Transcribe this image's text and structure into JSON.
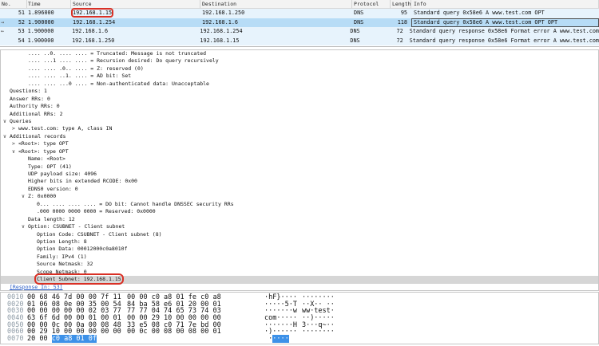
{
  "colors": {
    "row_default": "#e7f3fc",
    "row_selected": "#b7dcf6",
    "hex_highlight_bg": "#3d91e8",
    "annotation_red": "#d93025",
    "link_blue": "#2257c4",
    "selected_field_bg": "#d6d6d6",
    "hex_offset": "#8e9ba6",
    "pane_border": "#c6c6c6"
  },
  "icons": {
    "request-arrow": "→",
    "response-arrow": "←",
    "expanded": "∨",
    "collapsed": ">"
  },
  "packet_list": {
    "columns": [
      "No.",
      "Time",
      "Source",
      "Destination",
      "Protocol",
      "Length",
      "Info"
    ],
    "rows": [
      {
        "no": "51",
        "time": "1.896000",
        "source": "192.168.1.15",
        "destination": "192.168.1.250",
        "protocol": "DNS",
        "length": "95",
        "info": "Standard query 0x58e6 A www.test.com OPT",
        "source_red_box": true
      },
      {
        "no": "52",
        "time": "1.900000",
        "source": "192.168.1.254",
        "destination": "192.168.1.6",
        "protocol": "DNS",
        "length": "118",
        "info": "Standard query 0x58e6 A www.test.com OPT OPT",
        "selected": true,
        "info_outline": true,
        "marker": "request-arrow"
      },
      {
        "no": "53",
        "time": "1.900000",
        "source": "192.168.1.6",
        "destination": "192.168.1.254",
        "protocol": "DNS",
        "length": "72",
        "info": "Standard query response 0x58e6 Format error A www.test.com",
        "marker": "response-arrow"
      },
      {
        "no": "54",
        "time": "1.900000",
        "source": "192.168.1.250",
        "destination": "192.168.1.15",
        "protocol": "DNS",
        "length": "72",
        "info": "Standard query response 0x58e6 Format error A www.test.com"
      }
    ]
  },
  "details": {
    "lines": [
      {
        "t": ".... ..0. .... .... = Truncated: Message is not truncated",
        "d": 3
      },
      {
        "t": ".... ...1 .... .... = Recursion desired: Do query recursively",
        "d": 3
      },
      {
        "t": ".... .... .0.. .... = Z: reserved (0)",
        "d": 3
      },
      {
        "t": ".... .... ..1. .... = AD bit: Set",
        "d": 3
      },
      {
        "t": ".... .... ...0 .... = Non-authenticated data: Unacceptable",
        "d": 3
      },
      {
        "t": "Questions: 1",
        "d": 1
      },
      {
        "t": "Answer RRs: 0",
        "d": 1
      },
      {
        "t": "Authority RRs: 0",
        "d": 1
      },
      {
        "t": "Additional RRs: 2",
        "d": 1
      },
      {
        "t": "Queries",
        "d": 1,
        "a": "expanded"
      },
      {
        "t": "www.test.com: type A, class IN",
        "d": 2,
        "a": "collapsed"
      },
      {
        "t": "Additional records",
        "d": 1,
        "a": "expanded"
      },
      {
        "t": "<Root>: type OPT",
        "d": 2,
        "a": "collapsed"
      },
      {
        "t": "<Root>: type OPT",
        "d": 2,
        "a": "expanded"
      },
      {
        "t": "Name: <Root>",
        "d": 3
      },
      {
        "t": "Type: OPT (41)",
        "d": 3
      },
      {
        "t": "UDP payload size: 4096",
        "d": 3
      },
      {
        "t": "Higher bits in extended RCODE: 0x00",
        "d": 3
      },
      {
        "t": "EDNS0 version: 0",
        "d": 3
      },
      {
        "t": "Z: 0x0000",
        "d": 3,
        "a": "expanded"
      },
      {
        "t": "0... .... .... .... = DO bit: Cannot handle DNSSEC security RRs",
        "d": 4
      },
      {
        "t": ".000 0000 0000 0000 = Reserved: 0x0000",
        "d": 4
      },
      {
        "t": "Data length: 12",
        "d": 3
      },
      {
        "t": "Option: CSUBNET - Client subnet",
        "d": 3,
        "a": "expanded"
      },
      {
        "t": "Option Code: CSUBNET - Client subnet (8)",
        "d": 4
      },
      {
        "t": "Option Length: 8",
        "d": 4
      },
      {
        "t": "Option Data: 00012000c0a8010f",
        "d": 4
      },
      {
        "t": "Family: IPv4 (1)",
        "d": 4
      },
      {
        "t": "Source Netmask: 32",
        "d": 4
      },
      {
        "t": "Scope Netmask: 0",
        "d": 4
      },
      {
        "t": "Client Subnet: 192.168.1.15",
        "d": 4,
        "selected": true,
        "red_box": true
      },
      {
        "t": "[Response In: 53]",
        "d": 1,
        "link": true
      }
    ]
  },
  "hex": {
    "rows": [
      {
        "offset": "0010",
        "h1": "00 68 46 7d 00 00 7f 11",
        "h2": "00 00 c0 a8 01 fe c0 a8",
        "a1": "·hF}····",
        "a2": "········"
      },
      {
        "offset": "0020",
        "h1": "01 06 08 0e 00 35 00 54",
        "h2": "84 ba 58 e6 01 20 00 01",
        "a1": "·····5·T",
        "a2": "··X·· ··"
      },
      {
        "offset": "0030",
        "h1": "00 00 00 00 00 02 03 77",
        "h2": "77 77 04 74 65 73 74 03",
        "a1": "·······w",
        "a2": "ww·test·"
      },
      {
        "offset": "0040",
        "h1": "63 6f 6d 00 00 01 00 01",
        "h2": "00 00 29 10 00 00 00 00",
        "a1": "com·····",
        "a2": "··)·····"
      },
      {
        "offset": "0050",
        "h1": "00 00 0c 00 0a 00 08 48",
        "h2": "33 e5 08 c0 71 7e bd 00",
        "a1": "·······H",
        "a2": "3···q~··"
      },
      {
        "offset": "0060",
        "h1": "00 29 10 00 00 00 00 00",
        "h2": "00 0c 00 08 00 08 00 01",
        "a1": "·)······",
        "a2": "········"
      },
      {
        "offset": "0070",
        "h1": "20 00 ",
        "h1_hl": "c0 a8 01 0f",
        "h2": "",
        "a1": " ·",
        "a1_hl": "····",
        "a2": ""
      }
    ]
  }
}
